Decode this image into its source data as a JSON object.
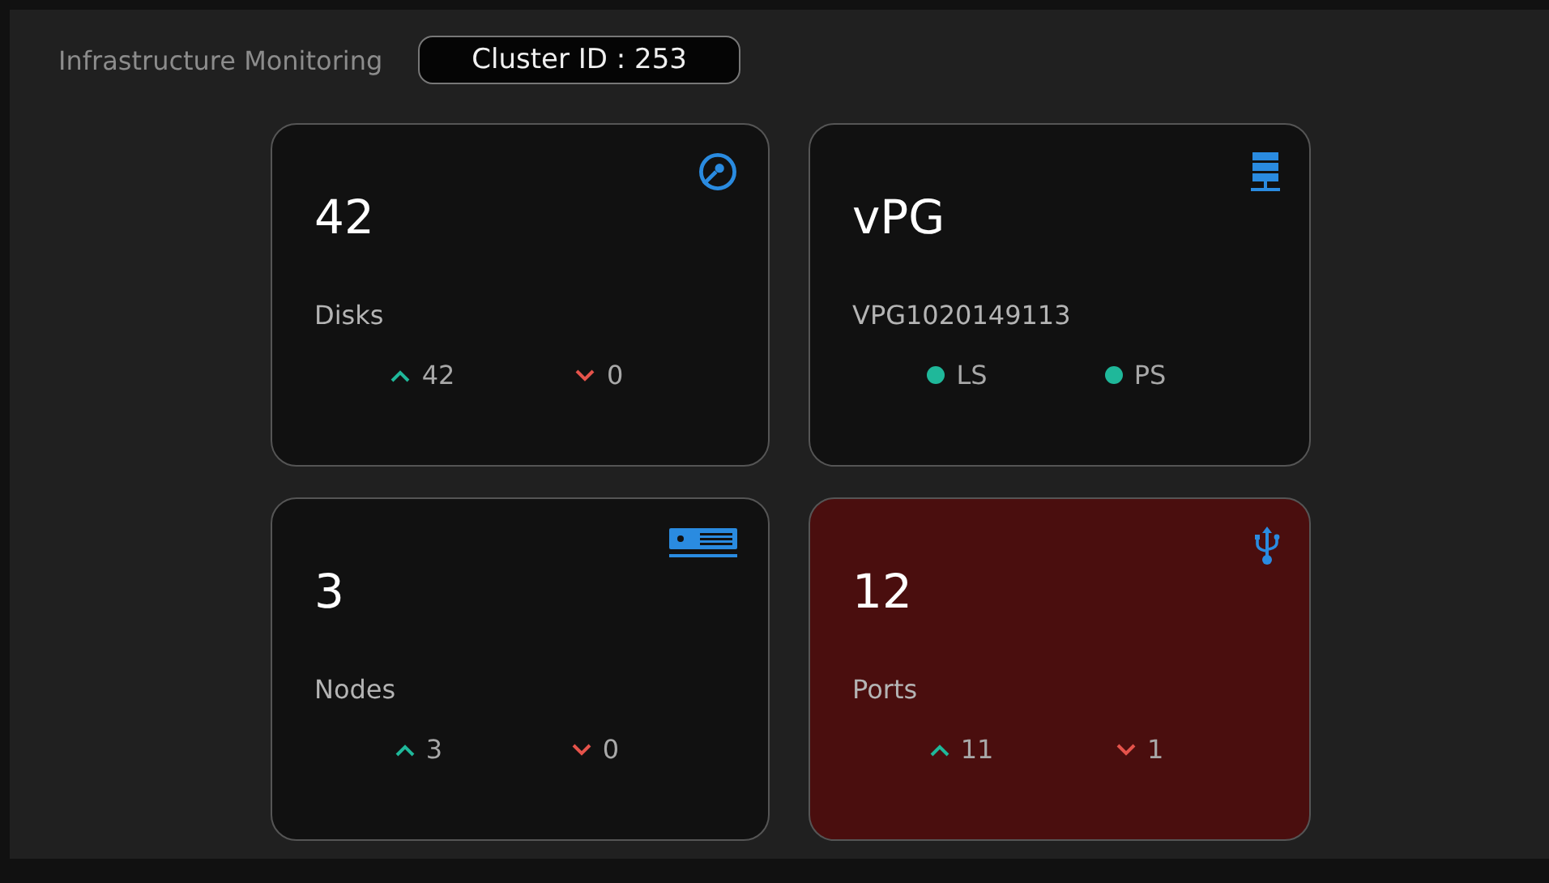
{
  "header": {
    "title": "Infrastructure Monitoring",
    "cluster": "Cluster ID : 253"
  },
  "cards": [
    {
      "kind": "counts",
      "value": "42",
      "label": "Disks",
      "alert": false,
      "up": "42",
      "down": "0"
    },
    {
      "kind": "status",
      "value": "vPG",
      "label": "VPG1020149113",
      "alert": false,
      "statuses": [
        {
          "label": "LS",
          "color": "#1fb89a"
        },
        {
          "label": "PS",
          "color": "#1fb89a"
        }
      ]
    },
    {
      "kind": "counts",
      "value": "3",
      "label": "Nodes",
      "alert": false,
      "up": "3",
      "down": "0"
    },
    {
      "kind": "counts",
      "value": "12",
      "label": "Ports",
      "alert": true,
      "up": "11",
      "down": "1"
    }
  ]
}
